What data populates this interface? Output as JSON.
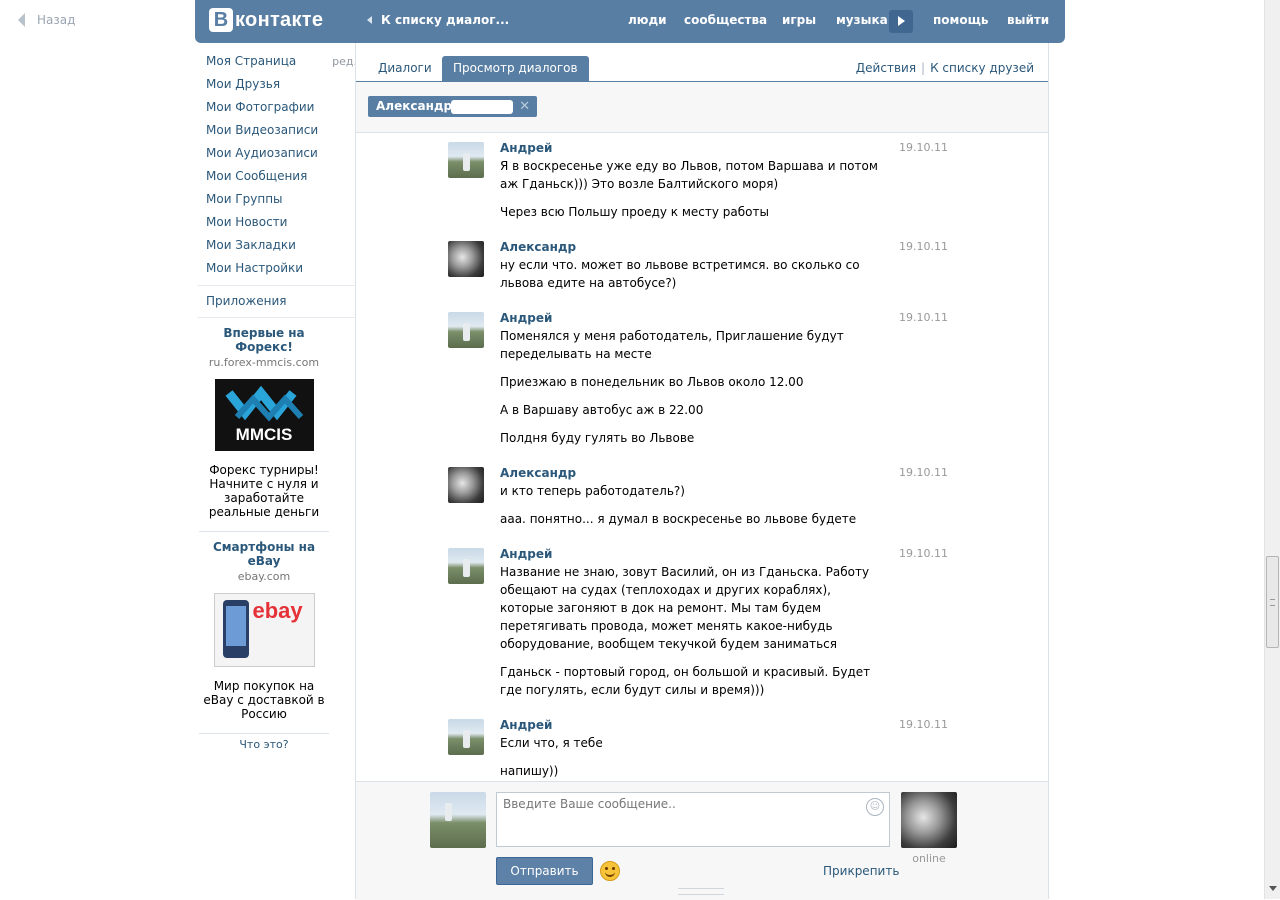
{
  "back": {
    "label": "Назад"
  },
  "header": {
    "logo_letter": "В",
    "logo_text": "контакте",
    "back_to_list": "К списку диалог...",
    "nav": [
      "люди",
      "сообщества",
      "игры",
      "музыка",
      "помощь",
      "выйти"
    ]
  },
  "sidebar": {
    "edit": "ред.",
    "items": [
      "Моя Страница",
      "Мои Друзья",
      "Мои Фотографии",
      "Мои Видеозаписи",
      "Мои Аудиозаписи",
      "Мои Сообщения",
      "Мои Группы",
      "Мои Новости",
      "Мои Закладки",
      "Мои Настройки"
    ],
    "apps": "Приложения",
    "ads": [
      {
        "title": "Впервые на Форекс!",
        "domain": "ru.forex-mmcis.com",
        "image_text": "MMCIS",
        "text": "Форекс турниры! Начните с нуля и заработайте реальные деньги"
      },
      {
        "title": "Смартфоны на eBay",
        "domain": "ebay.com",
        "image_text": "ebay",
        "text": "Мир покупок на eBay с доставкой в Россию"
      }
    ],
    "what_is_it": "Что это?"
  },
  "tabs": {
    "dialogs": "Диалоги",
    "view": "Просмотр диалогов",
    "actions": "Действия",
    "separator": "|",
    "to_friends": "К списку друзей"
  },
  "peer_tag": {
    "name": "Александр С",
    "close": "✕"
  },
  "messages": [
    {
      "author": "Андрей",
      "avatar": "andrey",
      "date": "19.10.11",
      "lines": [
        "Я в воскресенье уже еду во Львов, потом Варшава и потом аж Гданьск))) Это возле Балтийского моря)",
        "Через всю Польшу проеду к месту работы"
      ]
    },
    {
      "author": "Александр",
      "avatar": "sasha",
      "date": "19.10.11",
      "lines": [
        "ну если что. может во львове встретимся. во сколько со львова едите на автобусе?)"
      ]
    },
    {
      "author": "Андрей",
      "avatar": "andrey",
      "date": "19.10.11",
      "lines": [
        "Поменялся у меня работодатель, Приглашение будут переделывать на месте",
        "Приезжаю в понедельник во Львов около 12.00",
        "А в Варшаву автобус аж в 22.00",
        "Полдня буду гулять во Львове"
      ]
    },
    {
      "author": "Александр",
      "avatar": "sasha",
      "date": "19.10.11",
      "lines": [
        "и кто теперь работодатель?)",
        "ааа. понятно... я думал в воскресенье во львове будете"
      ]
    },
    {
      "author": "Андрей",
      "avatar": "andrey",
      "date": "19.10.11",
      "lines": [
        "Название не знаю, зовут Василий, он из Гданьска. Работу обещают на судах (теплоходах и других кораблях), которые загоняют в док на ремонт. Мы там будем перетягивать провода, может менять какое-нибудь оборудование, вообщем текучкой будем заниматься",
        "Гданьск - портовый город, он большой и красивый. Будет где погулять, если будут силы и время)))"
      ]
    },
    {
      "author": "Андрей",
      "avatar": "andrey",
      "date": "19.10.11",
      "lines": [
        "Если что, я тебе",
        "напишу))"
      ]
    }
  ],
  "composer": {
    "placeholder": "Введите Ваше сообщение..",
    "send": "Отправить",
    "attach": "Прикрепить",
    "status": "online"
  },
  "colors": {
    "header": "#587ea3",
    "link": "#2b587a",
    "button": "#5d81a7"
  }
}
